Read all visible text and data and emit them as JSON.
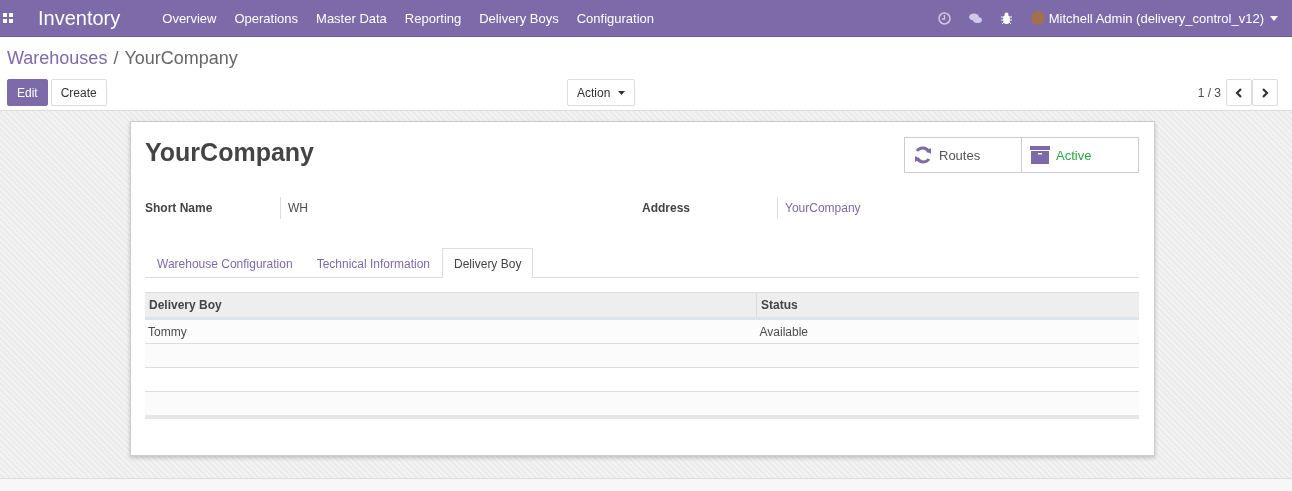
{
  "navbar": {
    "app_title": "Inventory",
    "menus": [
      "Overview",
      "Operations",
      "Master Data",
      "Reporting",
      "Delivery Boys",
      "Configuration"
    ],
    "user": "Mitchell Admin (delivery_control_v12)"
  },
  "breadcrumb": [
    {
      "label": "Warehouses",
      "kind": "link"
    },
    {
      "label": "YourCompany",
      "kind": "current"
    }
  ],
  "breadcrumb_separator": "/",
  "buttons": {
    "edit": "Edit",
    "create": "Create",
    "action": "Action"
  },
  "pager": "1 / 3",
  "record": {
    "title": "YourCompany",
    "smart_buttons": [
      {
        "label": "Routes",
        "kind": "routes"
      },
      {
        "label": "Active",
        "kind": "active"
      }
    ],
    "fields": [
      {
        "label": "Short Name",
        "value": "WH",
        "kind": "text"
      },
      {
        "label": "Address",
        "value": "YourCompany",
        "kind": "link"
      }
    ],
    "tabs": [
      {
        "label": "Warehouse Configuration",
        "selected": false
      },
      {
        "label": "Technical Information",
        "selected": false
      },
      {
        "label": "Delivery Boy",
        "selected": true
      }
    ],
    "table": {
      "columns": [
        "Delivery Boy",
        "Status"
      ],
      "rows": [
        [
          "Tommy",
          "Available"
        ]
      ]
    }
  }
}
